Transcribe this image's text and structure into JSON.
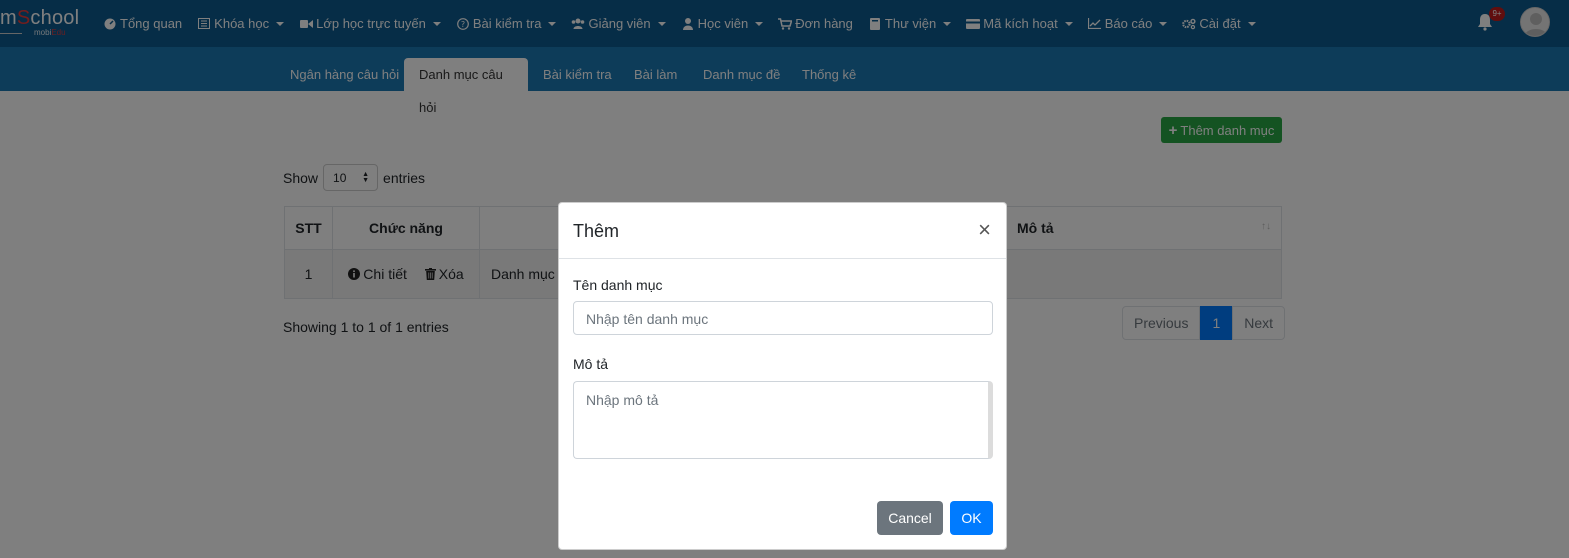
{
  "logo": {
    "brand_pre": "m",
    "brand_s": "S",
    "brand_post": "chool",
    "sub_pre": "mobi",
    "sub_post": "Edu"
  },
  "nav": [
    {
      "label": "Tổng quan",
      "icon": "dashboard-icon",
      "caret": false
    },
    {
      "label": "Khóa học",
      "icon": "list-icon",
      "caret": true
    },
    {
      "label": "Lớp học trực tuyến",
      "icon": "video-icon",
      "caret": true
    },
    {
      "label": "Bài kiểm tra",
      "icon": "question-icon",
      "caret": true
    },
    {
      "label": "Giảng viên",
      "icon": "users-icon",
      "caret": true
    },
    {
      "label": "Học viên",
      "icon": "user-icon",
      "caret": true
    },
    {
      "label": "Đơn hàng",
      "icon": "cart-icon",
      "caret": false
    },
    {
      "label": "Thư viện",
      "icon": "book-icon",
      "caret": true
    },
    {
      "label": "Mã kích hoạt",
      "icon": "card-icon",
      "caret": true
    },
    {
      "label": "Báo cáo",
      "icon": "chart-icon",
      "caret": true
    },
    {
      "label": "Cài đặt",
      "icon": "cogs-icon",
      "caret": true
    }
  ],
  "notifications": {
    "badge": "9+"
  },
  "tabs": [
    {
      "label": "Ngân hàng câu hỏi",
      "active": false
    },
    {
      "label": "Danh mục câu hỏi",
      "active": true
    },
    {
      "label": "Bài kiểm tra",
      "active": false
    },
    {
      "label": "Bài làm",
      "active": false
    },
    {
      "label": "Danh mục đề",
      "active": false
    },
    {
      "label": "Thống kê",
      "active": false
    }
  ],
  "add_button": "Thêm danh mục",
  "show": {
    "pre": "Show",
    "value": "10",
    "post": "entries"
  },
  "table": {
    "headers": {
      "stt": "STT",
      "function": "Chức năng",
      "desc": "Mô tả"
    },
    "row": {
      "stt": "1",
      "detail": "Chi tiết",
      "delete": "Xóa",
      "name": "Danh mục",
      "desc": ""
    }
  },
  "showing": "Showing 1 to 1 of 1 entries",
  "pager": {
    "prev": "Previous",
    "page": "1",
    "next": "Next"
  },
  "modal": {
    "title": "Thêm",
    "close": "×",
    "name_label": "Tên danh mục",
    "name_placeholder": "Nhập tên danh mục",
    "desc_label": "Mô tả",
    "desc_placeholder": "Nhập mô tả",
    "cancel": "Cancel",
    "ok": "OK"
  },
  "colors": {
    "topbar": "#0c5a8e",
    "subnav": "#1b78b3",
    "add": "#28a745",
    "primary": "#007bff",
    "secondary": "#6c757d"
  }
}
